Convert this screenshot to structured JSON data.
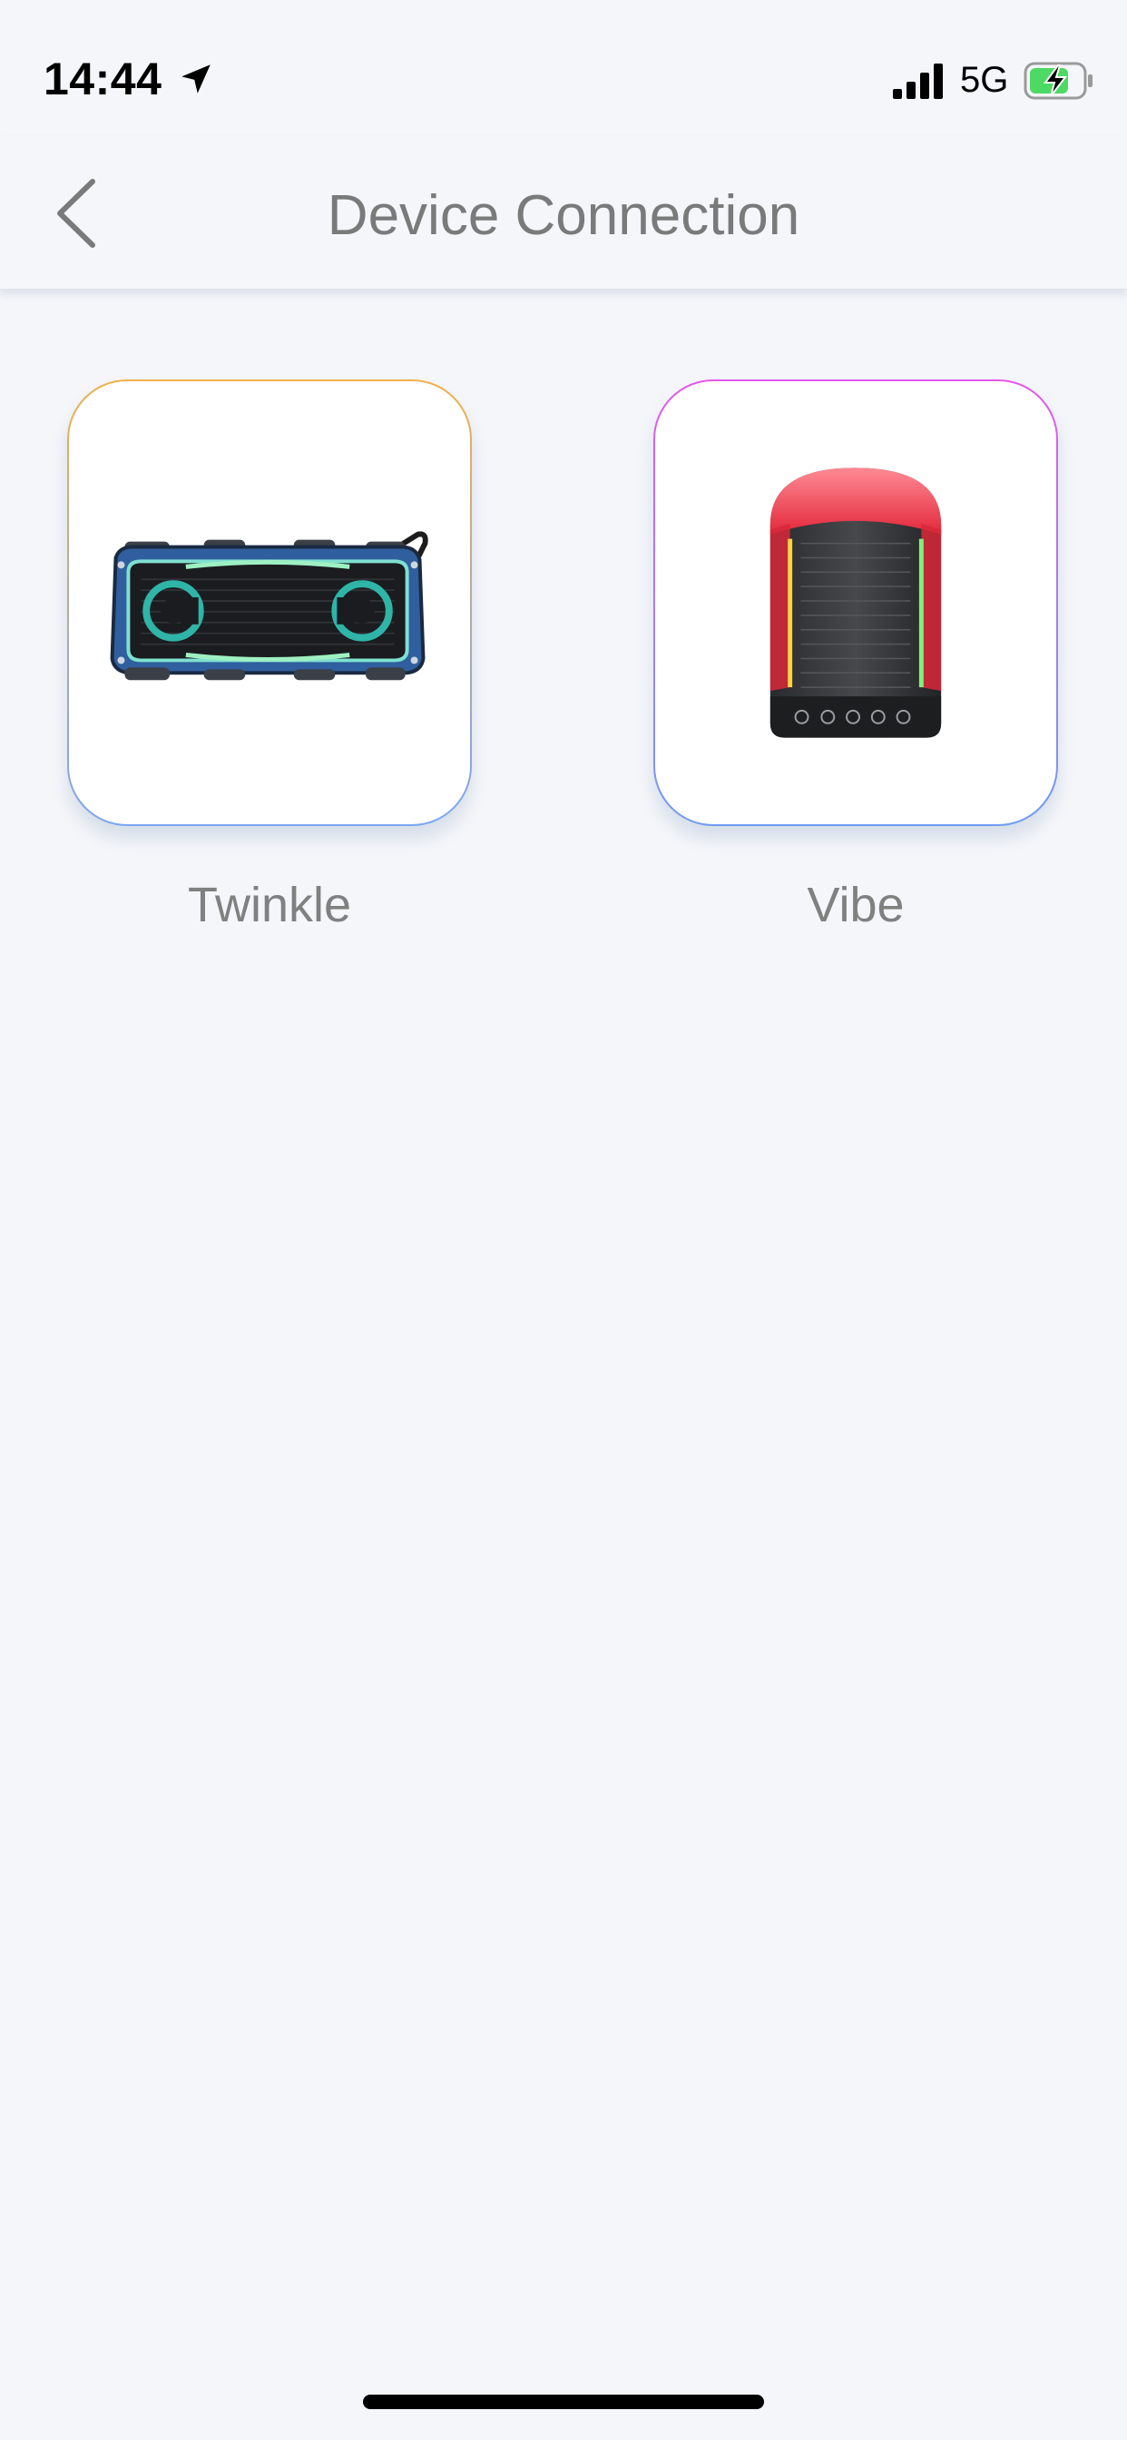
{
  "status_bar": {
    "time": "14:44",
    "network": "5G",
    "icons": [
      "location-arrow-icon",
      "signal-bars-icon",
      "battery-charging-icon"
    ]
  },
  "nav": {
    "title": "Device Connection",
    "back_icon": "chevron-left-icon"
  },
  "devices": [
    {
      "label": "Twinkle",
      "image": "rectangular-blue-bluetooth-speaker",
      "border_colors": [
        "#f2b04a",
        "#7aa6f2"
      ]
    },
    {
      "label": "Vibe",
      "image": "cylindrical-black-red-bluetooth-speaker",
      "border_colors": [
        "#e657e8",
        "#6e9cf2"
      ]
    }
  ],
  "colors": {
    "background": "#f4f6fa",
    "title_text": "#7a7a7a",
    "label_text": "#808080"
  }
}
